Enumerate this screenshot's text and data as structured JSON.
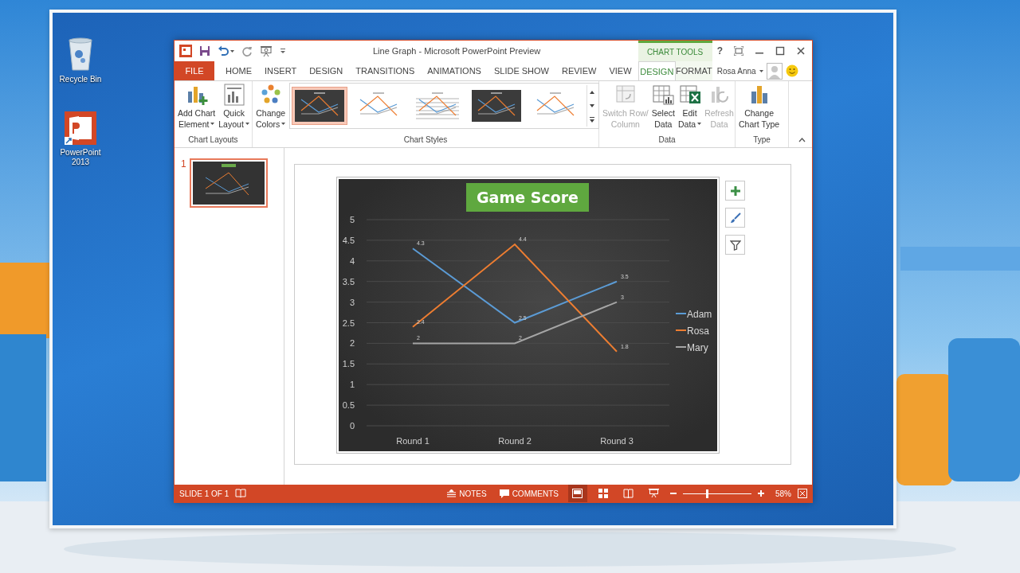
{
  "desktop_icons": [
    {
      "kind": "recycle-bin",
      "label": "Recycle Bin"
    },
    {
      "kind": "powerpoint",
      "label": "PowerPoint 2013"
    }
  ],
  "window": {
    "title": "Line Graph - Microsoft PowerPoint Preview",
    "context_group": "CHART TOOLS",
    "help": "?",
    "user": "Rosa Anna"
  },
  "tabs": [
    {
      "label": "FILE",
      "kind": "file",
      "selected": false
    },
    {
      "label": "HOME",
      "kind": "normal",
      "selected": false
    },
    {
      "label": "INSERT",
      "kind": "normal",
      "selected": false
    },
    {
      "label": "DESIGN",
      "kind": "normal",
      "selected": false
    },
    {
      "label": "TRANSITIONS",
      "kind": "normal",
      "selected": false
    },
    {
      "label": "ANIMATIONS",
      "kind": "normal",
      "selected": false
    },
    {
      "label": "SLIDE SHOW",
      "kind": "normal",
      "selected": false
    },
    {
      "label": "REVIEW",
      "kind": "normal",
      "selected": false
    },
    {
      "label": "VIEW",
      "kind": "normal",
      "selected": false
    },
    {
      "label": "DESIGN",
      "kind": "contextual",
      "selected": true
    },
    {
      "label": "FORMAT",
      "kind": "contextual",
      "selected": false
    }
  ],
  "ribbon": {
    "groups": [
      {
        "label": "Chart Layouts",
        "commands": [
          {
            "kind": "add-element",
            "lines": [
              "Add Chart",
              "Element"
            ],
            "dropdown": true,
            "disabled": false
          },
          {
            "kind": "quick-layout",
            "lines": [
              "Quick",
              "Layout"
            ],
            "dropdown": true,
            "disabled": false
          }
        ]
      },
      {
        "label": "Chart Styles",
        "commands": [
          {
            "kind": "change-colors",
            "lines": [
              "Change",
              "Colors"
            ],
            "dropdown": true,
            "disabled": false
          }
        ],
        "styles": [
          {
            "kind": "dark",
            "selected": true
          },
          {
            "kind": "light",
            "selected": false
          },
          {
            "kind": "grid",
            "selected": false
          },
          {
            "kind": "dark",
            "selected": false
          },
          {
            "kind": "light",
            "selected": false
          }
        ]
      },
      {
        "label": "Data",
        "commands": [
          {
            "kind": "switch-row",
            "lines": [
              "Switch Row/",
              "Column"
            ],
            "dropdown": false,
            "disabled": true
          },
          {
            "kind": "select-data",
            "lines": [
              "Select",
              "Data"
            ],
            "dropdown": false,
            "disabled": false
          },
          {
            "kind": "edit-data",
            "lines": [
              "Edit",
              "Data"
            ],
            "dropdown": true,
            "disabled": false
          },
          {
            "kind": "refresh-data",
            "lines": [
              "Refresh",
              "Data"
            ],
            "dropdown": false,
            "disabled": true
          }
        ]
      },
      {
        "label": "Type",
        "commands": [
          {
            "kind": "change-type",
            "lines": [
              "Change",
              "Chart Type"
            ],
            "dropdown": false,
            "disabled": false
          }
        ]
      }
    ]
  },
  "slides": [
    {
      "number": "1",
      "selected": true
    }
  ],
  "chart": {
    "chart_data": {
      "type": "line",
      "title": "Game Score",
      "categories": [
        "Round 1",
        "Round 2",
        "Round 3"
      ],
      "series": [
        {
          "name": "Adam",
          "color": "#5b9bd5",
          "values": [
            4.3,
            2.5,
            3.5
          ]
        },
        {
          "name": "Rosa",
          "color": "#ed7d31",
          "values": [
            2.4,
            4.4,
            1.8
          ]
        },
        {
          "name": "Mary",
          "color": "#a5a5a5",
          "values": [
            2,
            2,
            3
          ]
        }
      ],
      "ylim": [
        0,
        5
      ],
      "yticks": [
        0,
        0.5,
        1,
        1.5,
        2,
        2.5,
        3,
        3.5,
        4,
        4.5,
        5
      ],
      "data_labels": true,
      "grid": true,
      "legend": "right"
    }
  },
  "status_bar": {
    "slide_info": "SLIDE 1 OF 1",
    "notes": "NOTES",
    "comments": "COMMENTS",
    "views": [
      {
        "kind": "normal",
        "selected": true
      },
      {
        "kind": "sorter",
        "selected": false
      },
      {
        "kind": "reading",
        "selected": false
      },
      {
        "kind": "slideshow",
        "selected": false
      }
    ],
    "zoom": {
      "level": 0.35,
      "reading": "58%"
    }
  }
}
